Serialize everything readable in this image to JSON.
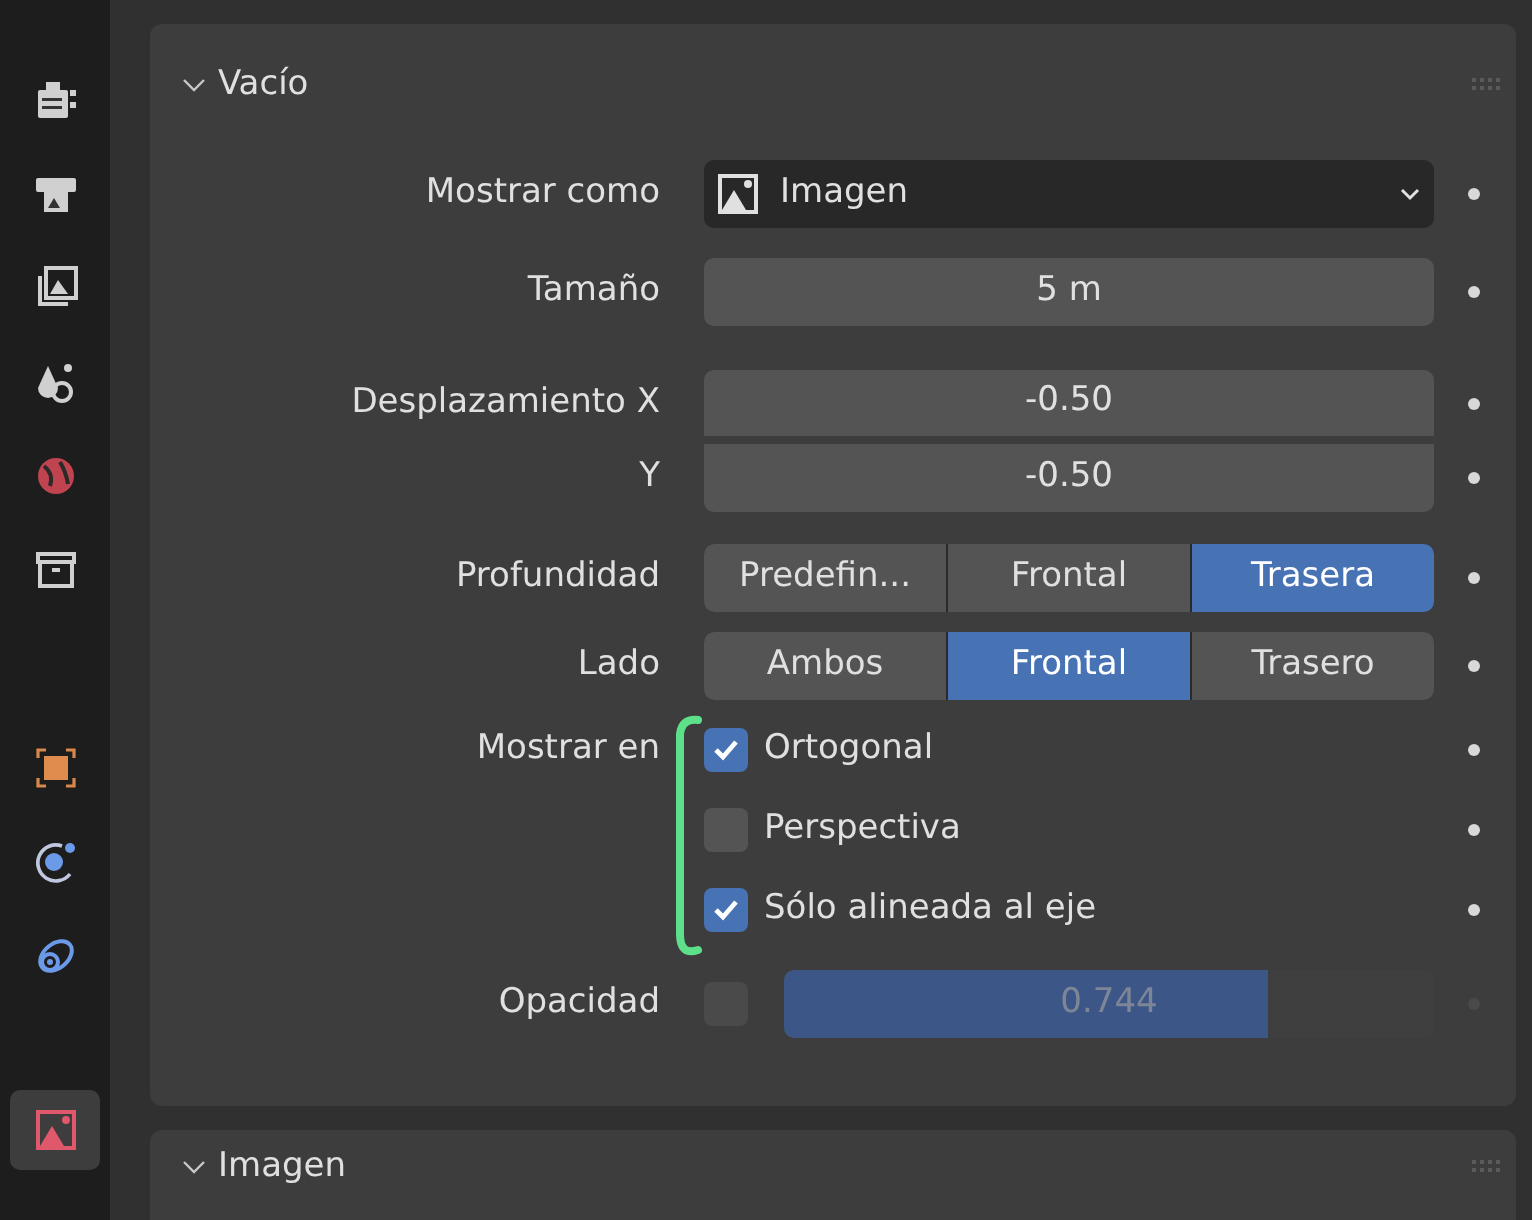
{
  "sidebar": {
    "tabs": [
      {
        "selected": false
      },
      {
        "selected": false
      },
      {
        "selected": false
      },
      {
        "selected": false
      },
      {
        "selected": false
      },
      {
        "selected": false
      },
      {
        "selected": false
      },
      {
        "selected": false
      },
      {
        "selected": false
      },
      {
        "selected": true
      }
    ]
  },
  "panels": [
    {
      "title": "Vacío",
      "expanded": true,
      "display_as": {
        "label": "Mostrar como",
        "value": "Imagen"
      },
      "size": {
        "label": "Tamaño",
        "value": "5 m"
      },
      "offset": [
        {
          "label": "Desplazamiento X",
          "value": "-0.50"
        },
        {
          "label": "Y",
          "value": "-0.50"
        }
      ],
      "depth": {
        "label": "Profundidad",
        "options": [
          {
            "label": "Predefin...",
            "selected": false
          },
          {
            "label": "Frontal",
            "selected": false
          },
          {
            "label": "Trasera",
            "selected": true
          }
        ]
      },
      "side": {
        "label": "Lado",
        "options": [
          {
            "label": "Ambos",
            "selected": false
          },
          {
            "label": "Frontal",
            "selected": true
          },
          {
            "label": "Trasero",
            "selected": false
          }
        ]
      },
      "show_in": {
        "label": "Mostrar en",
        "options": [
          {
            "label": "Ortogonal",
            "checked": true
          },
          {
            "label": "Perspectiva",
            "checked": false
          },
          {
            "label": "Sólo alineada al eje",
            "checked": true
          }
        ]
      },
      "opacity": {
        "label": "Opacidad",
        "checked": false,
        "value": "0.744",
        "level": 0.744
      }
    },
    {
      "title": "Imagen",
      "expanded": true
    }
  ]
}
